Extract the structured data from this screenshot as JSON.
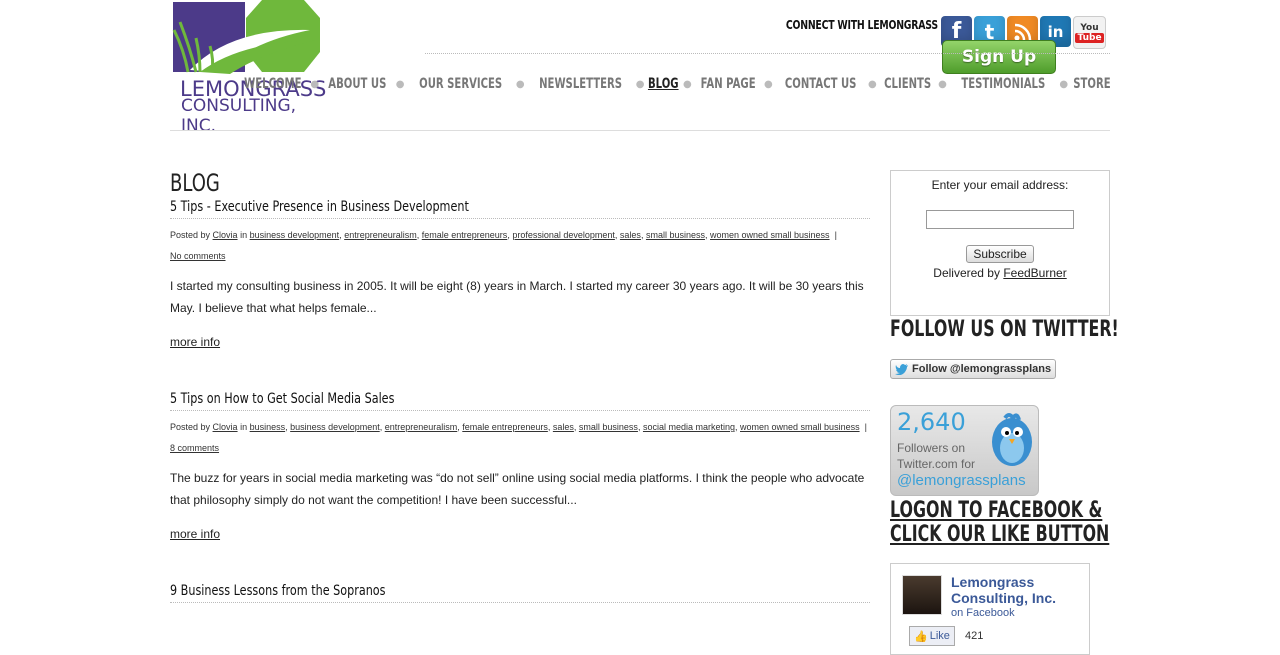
{
  "colors": {
    "accent_purple": "#4c3a89",
    "accent_green": "#6fb83c",
    "fb_blue": "#3b5998",
    "twitter_blue": "#3aa0d8"
  },
  "logo": {
    "line1": "LEMONGRASS",
    "line2": "CONSULTING, INC."
  },
  "header": {
    "connect_label": "CONNECT WITH LEMONGRASS",
    "social_icons": [
      "facebook-icon",
      "twitter-icon",
      "rss-icon",
      "linkedin-icon",
      "youtube-icon"
    ],
    "signup_label": "Sign Up"
  },
  "nav": {
    "items": [
      {
        "label": "WELCOME"
      },
      {
        "label": "ABOUT US"
      },
      {
        "label": "OUR SERVICES"
      },
      {
        "label": "NEWSLETTERS"
      },
      {
        "label": "BLOG"
      },
      {
        "label": "FAN PAGE"
      },
      {
        "label": "CONTACT US"
      },
      {
        "label": "CLIENTS"
      },
      {
        "label": "TESTIMONIALS"
      },
      {
        "label": "STORE"
      }
    ]
  },
  "main": {
    "heading": "BLOG",
    "posts": [
      {
        "title": "5 Tips - Executive Presence in Business Development",
        "posted_by": "Posted by",
        "author": "Clovia",
        "in": "in",
        "categories": [
          "business development",
          "entrepreneuralism",
          "female entrepreneurs",
          "professional development",
          "sales",
          "small business",
          "women owned small business"
        ],
        "comments": "No comments",
        "excerpt": "I started my consulting business in 2005.  It will be eight (8) years in March.  I started my career 30 years ago.  It will be 30 years this May.  I believe that what helps female...",
        "more": "more info"
      },
      {
        "title": "5 Tips on How to Get Social Media Sales",
        "posted_by": "Posted by",
        "author": "Clovia",
        "in": "in",
        "categories": [
          "business",
          "business development",
          "entrepreneuralism",
          "female entrepreneurs",
          "sales",
          "small business",
          "social media marketing",
          "women owned small business"
        ],
        "comments": "8 comments",
        "excerpt": "The buzz for years in social media marketing was “do not sell” online using social media platforms. I think the people who advocate that philosophy simply do not want the competition! I have been successful...",
        "more": "more info"
      },
      {
        "title": "9 Business Lessons from the Sopranos"
      }
    ]
  },
  "sidebar": {
    "email_label": "Enter your email address:",
    "subscribe_label": "Subscribe",
    "delivered_by": "Delivered by",
    "feedburner": "FeedBurner",
    "twitter_heading": "FOLLOW US ON TWITTER!",
    "twitter_follow": "Follow @lemongrassplans",
    "twitter_badge": {
      "count": "2,640",
      "line1": "Followers on",
      "line2": "Twitter.com for",
      "handle": "@lemongrassplans"
    },
    "facebook_heading_1": "LOGON TO FACEBOOK &",
    "facebook_heading_2": "CLICK OUR LIKE BUTTON",
    "fb_page": {
      "name_1": "Lemongrass",
      "name_2": "Consulting, Inc.",
      "on_facebook": "on Facebook",
      "like": "Like",
      "count": "421"
    }
  }
}
